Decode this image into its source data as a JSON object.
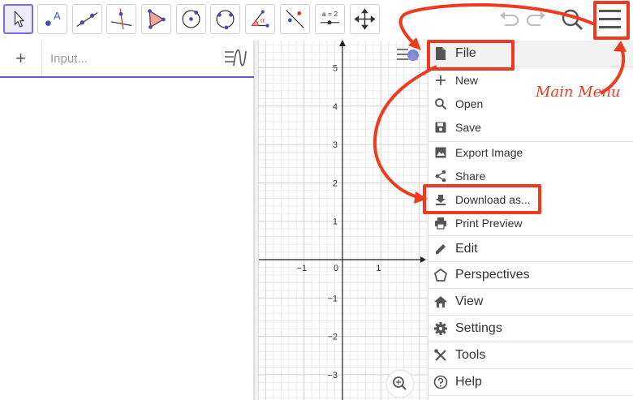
{
  "algebra": {
    "add_symbol": "+",
    "input_placeholder": "Input..."
  },
  "toolbar": {
    "tools": [
      {
        "name": "move-tool-icon"
      },
      {
        "name": "point-tool-icon",
        "glyph": "A"
      },
      {
        "name": "line-tool-icon"
      },
      {
        "name": "perpendicular-line-tool-icon"
      },
      {
        "name": "polygon-tool-icon"
      },
      {
        "name": "circle-center-point-tool-icon"
      },
      {
        "name": "circle-three-points-tool-icon"
      },
      {
        "name": "angle-tool-icon",
        "glyph": "α"
      },
      {
        "name": "reflect-tool-icon"
      },
      {
        "name": "slider-tool-icon",
        "glyph": "a = 2"
      },
      {
        "name": "move-graphics-view-tool-icon"
      }
    ],
    "right_icons": [
      "undo-icon",
      "redo-icon",
      "search-icon",
      "hamburger-menu-icon"
    ]
  },
  "graphics": {
    "x_ticks": [
      "−1",
      "0",
      "1"
    ],
    "y_ticks": [
      "5",
      "4",
      "3",
      "2",
      "1",
      "−1",
      "−2",
      "−3"
    ],
    "icons": [
      "style-bar-toggle-icon",
      "zoom-icon"
    ]
  },
  "menu": {
    "file": "File",
    "file_items": [
      {
        "label": "New",
        "icon": "plus-icon"
      },
      {
        "label": "Open",
        "icon": "search-icon"
      },
      {
        "label": "Save",
        "icon": "save-icon"
      },
      {
        "label": "Export Image",
        "icon": "image-icon"
      },
      {
        "label": "Share",
        "icon": "share-icon"
      },
      {
        "label": "Download as...",
        "icon": "download-icon"
      },
      {
        "label": "Print Preview",
        "icon": "print-icon"
      }
    ],
    "sections": [
      {
        "label": "Edit",
        "icon": "pencil-icon"
      },
      {
        "label": "Perspectives",
        "icon": "perspectives-icon"
      },
      {
        "label": "View",
        "icon": "home-icon"
      },
      {
        "label": "Settings",
        "icon": "gear-icon"
      },
      {
        "label": "Tools",
        "icon": "tools-icon"
      },
      {
        "label": "Help",
        "icon": "help-icon"
      }
    ]
  },
  "annotation": {
    "label": "Main Menu",
    "color": "#ee3a1e"
  }
}
